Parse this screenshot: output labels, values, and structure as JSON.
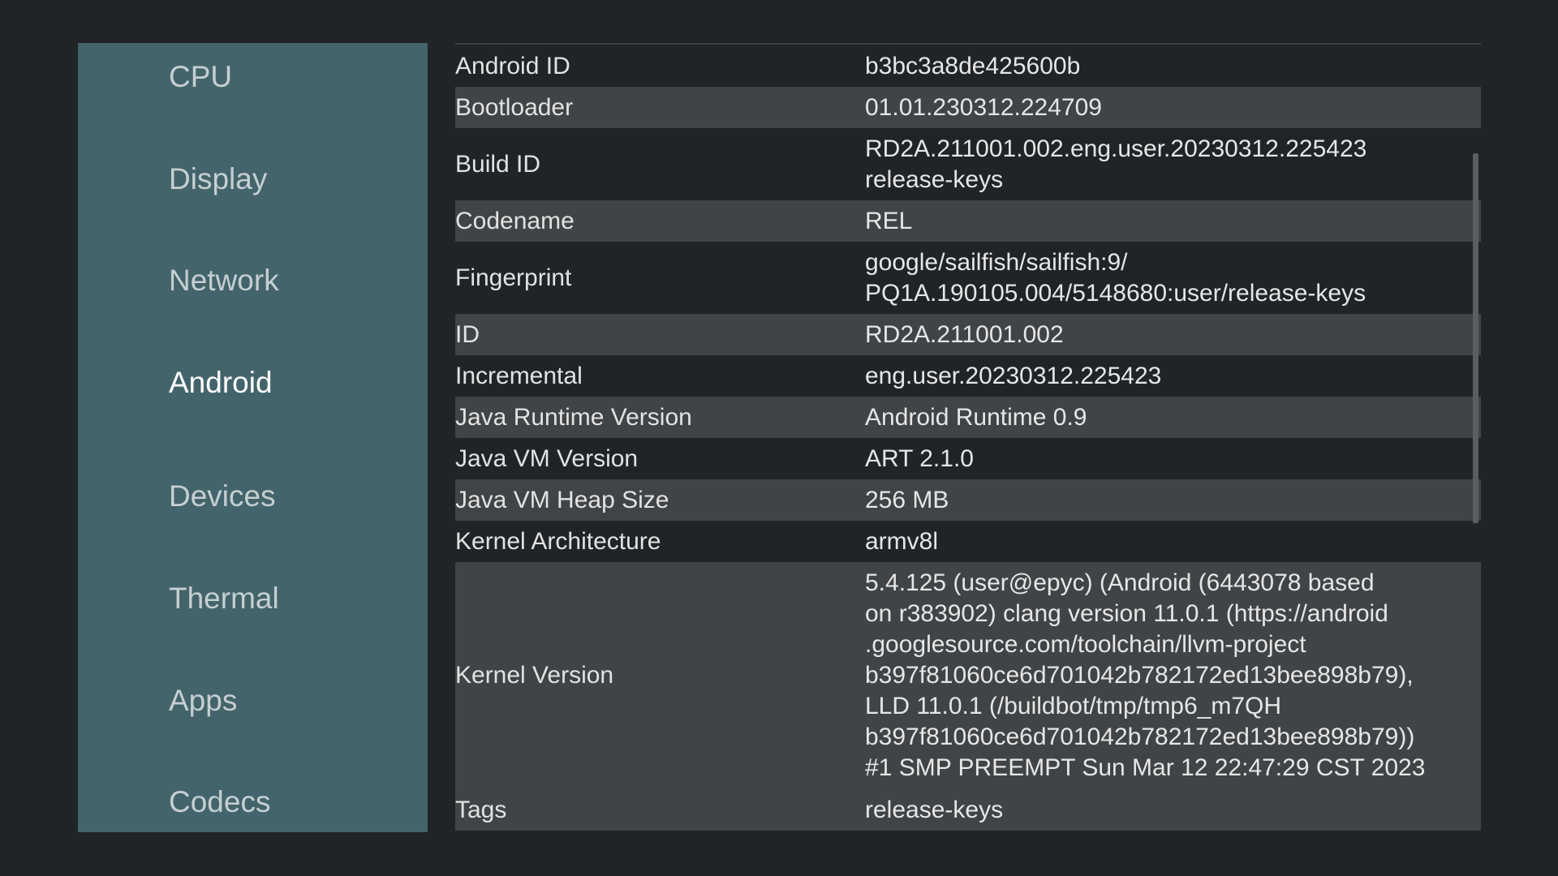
{
  "sidebar": {
    "items": [
      {
        "label": "CPU",
        "selected": false
      },
      {
        "label": "Display",
        "selected": false
      },
      {
        "label": "Network",
        "selected": false
      },
      {
        "label": "Android",
        "selected": true
      },
      {
        "label": "Devices",
        "selected": false
      },
      {
        "label": "Thermal",
        "selected": false
      },
      {
        "label": "Apps",
        "selected": false
      },
      {
        "label": "Codecs",
        "selected": false
      }
    ]
  },
  "details": {
    "rows": [
      {
        "key": "Android ID",
        "value": "b3bc3a8de425600b"
      },
      {
        "key": "Bootloader",
        "value": "01.01.230312.224709"
      },
      {
        "key": "Build ID",
        "value": "RD2A.211001.002.eng.user.20230312.225423\nrelease-keys"
      },
      {
        "key": "Codename",
        "value": "REL"
      },
      {
        "key": "Fingerprint",
        "value": "google/sailfish/sailfish:9/\nPQ1A.190105.004/5148680:user/release-keys"
      },
      {
        "key": "ID",
        "value": "RD2A.211001.002"
      },
      {
        "key": "Incremental",
        "value": "eng.user.20230312.225423"
      },
      {
        "key": "Java Runtime Version",
        "value": "Android Runtime 0.9"
      },
      {
        "key": "Java VM Version",
        "value": "ART 2.1.0"
      },
      {
        "key": "Java VM Heap Size",
        "value": "256 MB"
      },
      {
        "key": "Kernel Architecture",
        "value": "armv8l"
      },
      {
        "key": "Kernel Version",
        "value": "5.4.125 (user@epyc) (Android (6443078 based\non r383902) clang version 11.0.1 (https://android\n.googlesource.com/toolchain/llvm-project\nb397f81060ce6d701042b782172ed13bee898b79),\nLLD 11.0.1 (/buildbot/tmp/tmp6_m7QH\nb397f81060ce6d701042b782172ed13bee898b79))\n#1 SMP PREEMPT Sun Mar 12 22:47:29 CST 2023"
      },
      {
        "key": "Tags",
        "value": "release-keys"
      }
    ]
  },
  "colors": {
    "background": "#202427",
    "sidebar": "#44646b",
    "row_shade": "#414446",
    "selected_text": "#ffffff",
    "nav_text": "#c4cfd2"
  }
}
